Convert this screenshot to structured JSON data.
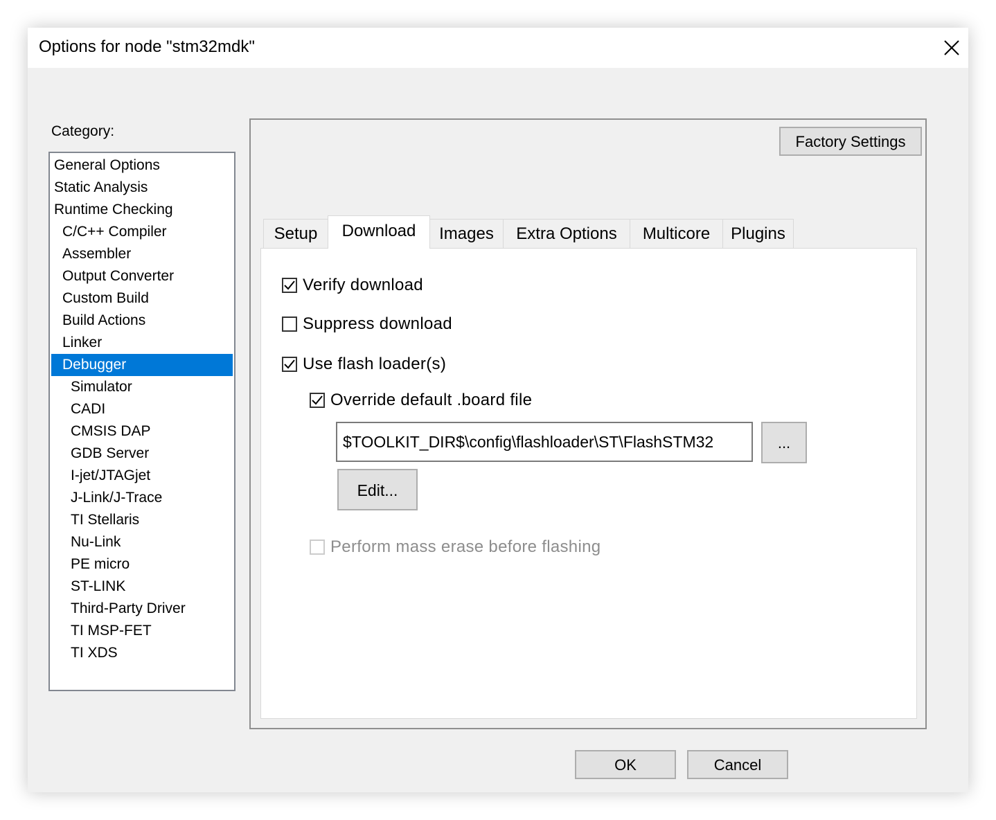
{
  "window": {
    "title": "Options for node \"stm32mdk\""
  },
  "category": {
    "label": "Category:",
    "items": [
      {
        "label": "General Options",
        "level": 0
      },
      {
        "label": "Static Analysis",
        "level": 0
      },
      {
        "label": "Runtime Checking",
        "level": 0
      },
      {
        "label": "C/C++ Compiler",
        "level": 1
      },
      {
        "label": "Assembler",
        "level": 1
      },
      {
        "label": "Output Converter",
        "level": 1
      },
      {
        "label": "Custom Build",
        "level": 1
      },
      {
        "label": "Build Actions",
        "level": 1
      },
      {
        "label": "Linker",
        "level": 1
      },
      {
        "label": "Debugger",
        "level": 1,
        "selected": true
      },
      {
        "label": "Simulator",
        "level": 2
      },
      {
        "label": "CADI",
        "level": 2
      },
      {
        "label": "CMSIS DAP",
        "level": 2
      },
      {
        "label": "GDB Server",
        "level": 2
      },
      {
        "label": "I-jet/JTAGjet",
        "level": 2
      },
      {
        "label": "J-Link/J-Trace",
        "level": 2
      },
      {
        "label": "TI Stellaris",
        "level": 2
      },
      {
        "label": "Nu-Link",
        "level": 2
      },
      {
        "label": "PE micro",
        "level": 2
      },
      {
        "label": "ST-LINK",
        "level": 2
      },
      {
        "label": "Third-Party Driver",
        "level": 2
      },
      {
        "label": "TI MSP-FET",
        "level": 2
      },
      {
        "label": "TI XDS",
        "level": 2
      }
    ]
  },
  "panel": {
    "factory_settings": "Factory Settings",
    "tabs": [
      {
        "label": "Setup"
      },
      {
        "label": "Download",
        "active": true
      },
      {
        "label": "Images"
      },
      {
        "label": "Extra Options"
      },
      {
        "label": "Multicore"
      },
      {
        "label": "Plugins"
      }
    ]
  },
  "download": {
    "verify": {
      "label": "Verify download",
      "checked": true
    },
    "suppress": {
      "label": "Suppress download",
      "checked": false
    },
    "use_flash_loader": {
      "label": "Use flash loader(s)",
      "checked": true
    },
    "override_board": {
      "label": "Override default .board file",
      "checked": true
    },
    "board_path": "$TOOLKIT_DIR$\\config\\flashloader\\ST\\FlashSTM32",
    "browse_label": "...",
    "edit_label": "Edit...",
    "mass_erase": {
      "label": "Perform mass erase before flashing",
      "checked": false,
      "disabled": true
    }
  },
  "footer": {
    "ok_label": "OK",
    "cancel_label": "Cancel"
  },
  "colors": {
    "selection": "#0078d7",
    "dialog_bg": "#f0f0f0",
    "button_bg": "#e1e1e1"
  }
}
